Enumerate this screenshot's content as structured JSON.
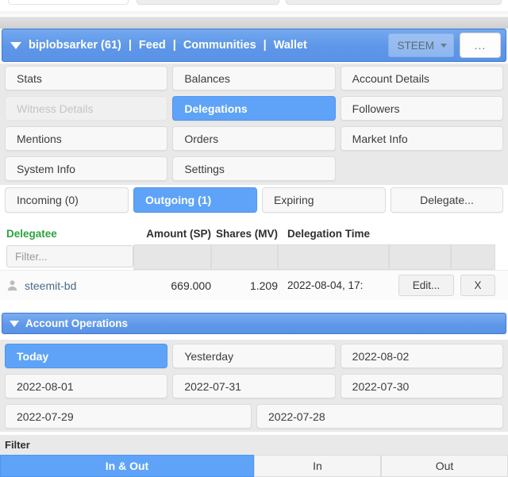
{
  "header": {
    "caret_icon": "caret-down-icon",
    "username": "biplobsarker (61)",
    "separator": "|",
    "links": [
      "Feed",
      "Communities",
      "Wallet"
    ],
    "currency_select": {
      "value": "STEEM",
      "caret_icon": "caret-down-icon"
    },
    "more_button": "...",
    "accent_blue": "#5a92e6"
  },
  "nav_grid": {
    "rows": [
      [
        {
          "label": "Stats",
          "state": "normal"
        },
        {
          "label": "Balances",
          "state": "normal"
        },
        {
          "label": "Account Details",
          "state": "normal"
        }
      ],
      [
        {
          "label": "Witness Details",
          "state": "disabled"
        },
        {
          "label": "Delegations",
          "state": "active"
        },
        {
          "label": "Followers",
          "state": "normal"
        }
      ],
      [
        {
          "label": "Mentions",
          "state": "normal"
        },
        {
          "label": "Orders",
          "state": "normal"
        },
        {
          "label": "Market Info",
          "state": "normal"
        }
      ],
      [
        {
          "label": "System Info",
          "state": "normal"
        },
        {
          "label": "Settings",
          "state": "normal"
        },
        {
          "label": "",
          "state": "empty"
        }
      ]
    ]
  },
  "subtabs": [
    {
      "label": "Incoming (0)",
      "state": "normal"
    },
    {
      "label": "Outgoing (1)",
      "state": "active"
    },
    {
      "label": "Expiring",
      "state": "normal"
    },
    {
      "label": "Delegate...",
      "state": "normal"
    }
  ],
  "delegation_table": {
    "columns": [
      "Delegatee",
      "Amount (SP)",
      "Shares (MV)",
      "Delegation Time"
    ],
    "header_accent": "#2aa33e",
    "filter_placeholder": "Filter...",
    "rows": [
      {
        "avatar_icon": "person-icon",
        "delegatee": "steemit-bd",
        "amount": "669.000",
        "shares": "1.209",
        "time": "2022-08-04, 17:",
        "edit_label": "Edit...",
        "delete_label": "X"
      }
    ]
  },
  "account_operations": {
    "caret_icon": "caret-down-icon",
    "title": "Account Operations",
    "date_rows": [
      [
        {
          "label": "Today",
          "state": "active"
        },
        {
          "label": "Yesterday",
          "state": "normal"
        },
        {
          "label": "2022-08-02",
          "state": "normal"
        }
      ],
      [
        {
          "label": "2022-08-01",
          "state": "normal"
        },
        {
          "label": "2022-07-31",
          "state": "normal"
        },
        {
          "label": "2022-07-30",
          "state": "normal"
        }
      ],
      [
        {
          "label": "2022-07-29",
          "state": "normal"
        },
        {
          "label": "2022-07-28",
          "state": "normal"
        }
      ]
    ]
  },
  "bottom_filter": {
    "label": "Filter",
    "options": [
      {
        "label": "In & Out",
        "state": "active"
      },
      {
        "label": "In",
        "state": "normal"
      },
      {
        "label": "Out",
        "state": "normal"
      }
    ]
  }
}
